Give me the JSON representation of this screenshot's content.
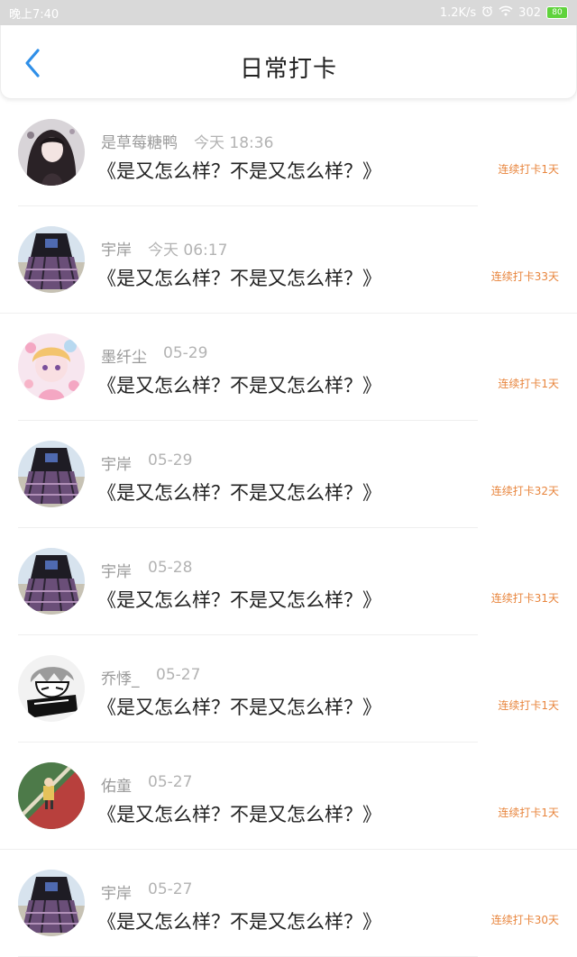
{
  "status_bar": {
    "time": "晚上7:40",
    "speed": "1.2K/s",
    "signal": "302",
    "battery": "80",
    "icons": [
      "alarm-icon",
      "wifi-icon"
    ]
  },
  "header": {
    "title": "日常打卡",
    "back_icon": "chevron-left-icon",
    "accent": "#2f8fe8"
  },
  "colors": {
    "streak": "#e8853d",
    "name": "#9a9a9a"
  },
  "posts": [
    {
      "name": "是草莓糖鸭",
      "date": "今天 18:36",
      "content": "《是又怎么样？不是又怎么样？》",
      "streak": "连续打卡1天",
      "avatar": "avatar-girl-dark"
    },
    {
      "name": "宇岸",
      "date": "今天 06:17",
      "content": "《是又怎么样？不是又怎么样？》",
      "streak": "连续打卡33天",
      "avatar": "avatar-plaid-skirt"
    },
    {
      "name": "墨纤尘",
      "date": "05-29",
      "content": "《是又怎么样？不是又怎么样？》",
      "streak": "连续打卡1天",
      "avatar": "avatar-pink-anime"
    },
    {
      "name": "宇岸",
      "date": "05-29",
      "content": "《是又怎么样？不是又怎么样？》",
      "streak": "连续打卡32天",
      "avatar": "avatar-plaid-skirt"
    },
    {
      "name": "宇岸",
      "date": "05-28",
      "content": "《是又怎么样？不是又怎么样？》",
      "streak": "连续打卡31天",
      "avatar": "avatar-plaid-skirt"
    },
    {
      "name": "乔悸_",
      "date": "05-27",
      "content": "《是又怎么样？不是又怎么样？》",
      "streak": "连续打卡1天",
      "avatar": "avatar-manga-boy"
    },
    {
      "name": "佑童",
      "date": "05-27",
      "content": "《是又怎么样？不是又怎么样？》",
      "streak": "连续打卡1天",
      "avatar": "avatar-green-red"
    },
    {
      "name": "宇岸",
      "date": "05-27",
      "content": "《是又怎么样？不是又怎么样？》",
      "streak": "连续打卡30天",
      "avatar": "avatar-plaid-skirt"
    }
  ]
}
